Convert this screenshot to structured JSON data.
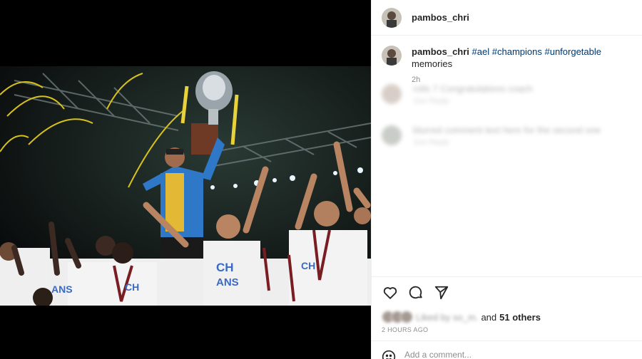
{
  "post": {
    "username": "pambos_chri",
    "caption": {
      "username": "pambos_chri",
      "tags": [
        "#ael",
        "#champions",
        "#unforgetable"
      ],
      "text": "memories",
      "time": "2h"
    },
    "photo": {
      "banner": "CHA MPIONS",
      "shirt_text_1": "CH",
      "shirt_text_2": "ANS"
    }
  },
  "comments": [
    {
      "text": "rolls 7 Congratulations coach",
      "sub": "11w   Reply"
    },
    {
      "text": "blurred comment text here for the second one",
      "sub": "11w   Reply"
    }
  ],
  "icons": {
    "like": "heart-icon",
    "comment": "comment-bubble-icon",
    "share": "send-icon",
    "emoji": "emoji-icon"
  },
  "likes": {
    "liked_by_blurred": "Liked by so_m.",
    "and_label": "and",
    "others_label": "51 others"
  },
  "timestamp": "2 HOURS AGO",
  "comment_box": {
    "placeholder": "Add a comment..."
  },
  "colors": {
    "hashtag": "#00376b",
    "muted": "#8e8e8e",
    "divider": "#efefef"
  }
}
